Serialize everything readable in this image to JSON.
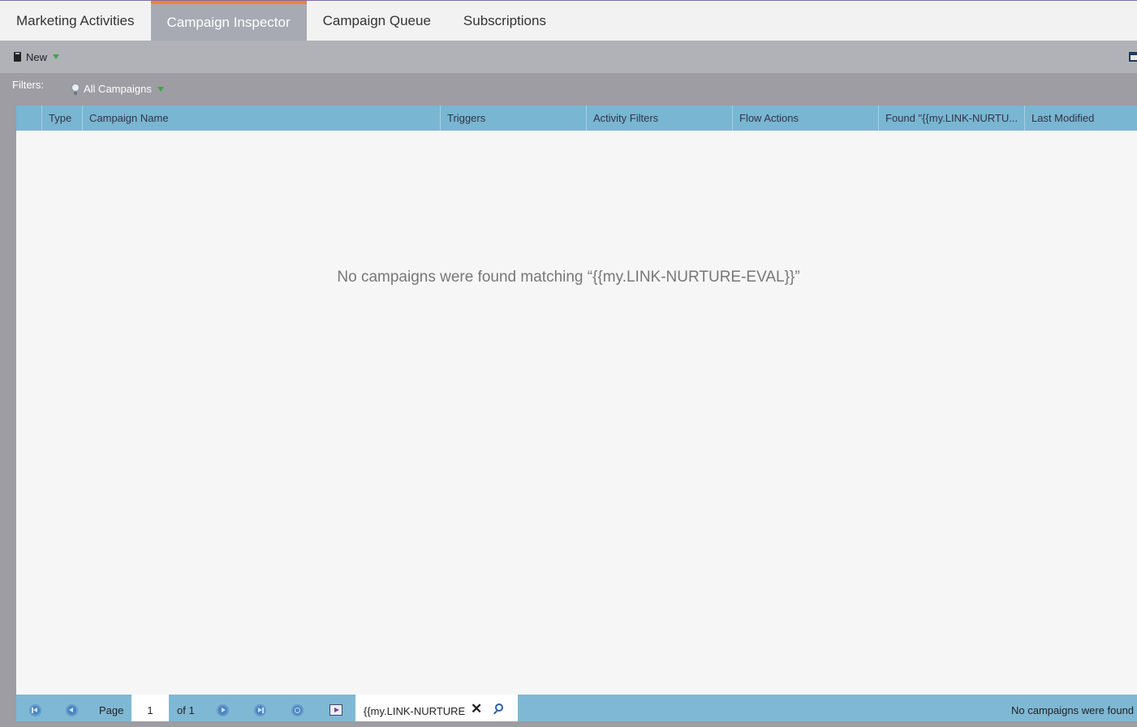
{
  "tabs": [
    {
      "label": "Marketing Activities",
      "active": false
    },
    {
      "label": "Campaign Inspector",
      "active": true
    },
    {
      "label": "Campaign Queue",
      "active": false
    },
    {
      "label": "Subscriptions",
      "active": false
    }
  ],
  "toolbar": {
    "new_label": "New"
  },
  "filters": {
    "label": "Filters:",
    "selected": "All Campaigns"
  },
  "grid": {
    "columns": [
      "",
      "Type",
      "Campaign Name",
      "Triggers",
      "Activity Filters",
      "Flow Actions",
      "Found \"{{my.LINK-NURTU...",
      "Last Modified"
    ],
    "empty_message": "No campaigns were found matching “{{my.LINK-NURTURE-EVAL}}”"
  },
  "pager": {
    "page_label": "Page",
    "page_value": "1",
    "of_label": "of 1",
    "search_value": "{{my.LINK-NURTURE-EVAL}}",
    "status": "No campaigns were found"
  },
  "colors": {
    "active_tab_accent": "#f0803c",
    "grid_header": "#79b6d2",
    "pager_bar": "#7fb8d4"
  }
}
